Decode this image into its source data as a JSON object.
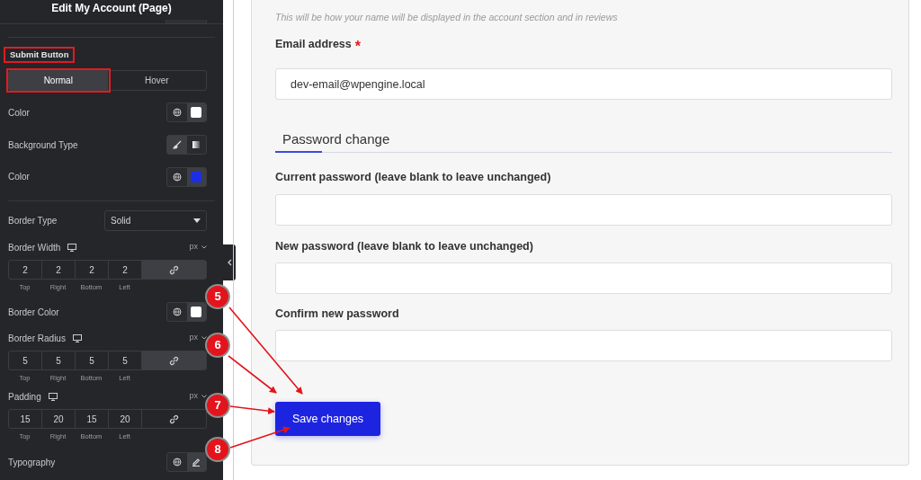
{
  "panel": {
    "title": "Edit My Account (Page)",
    "section_title": "Submit Button",
    "section_highlighted": true,
    "tabs": [
      {
        "label": "Normal",
        "selected": true,
        "highlighted": true
      },
      {
        "label": "Hover",
        "selected": false,
        "highlighted": false
      }
    ],
    "controls": [
      {
        "kind": "color",
        "label": "Color",
        "color": "#ffffff"
      },
      {
        "kind": "background",
        "label": "Background Type",
        "options": [
          {
            "selected": true
          },
          {
            "selected": false
          }
        ]
      },
      {
        "kind": "color",
        "label": "Color",
        "color": "#1a2ee6"
      },
      {
        "kind": "divider"
      },
      {
        "kind": "select",
        "label": "Border Type",
        "value": "Solid"
      },
      {
        "kind": "dimensions",
        "label": "Border Width",
        "unit": "px",
        "linked": true,
        "values": [
          {
            "value": "2",
            "label": "Top"
          },
          {
            "value": "2",
            "label": "Right"
          },
          {
            "value": "2",
            "label": "Bottom"
          },
          {
            "value": "2",
            "label": "Left"
          }
        ]
      },
      {
        "kind": "color",
        "label": "Border Color",
        "color": "#ffffff"
      },
      {
        "kind": "dimensions",
        "label": "Border Radius",
        "unit": "px",
        "linked": true,
        "values": [
          {
            "value": "5",
            "label": "Top"
          },
          {
            "value": "5",
            "label": "Right"
          },
          {
            "value": "5",
            "label": "Bottom"
          },
          {
            "value": "5",
            "label": "Left"
          }
        ]
      },
      {
        "kind": "dimensions",
        "label": "Padding",
        "unit": "px",
        "linked": false,
        "values": [
          {
            "value": "15",
            "label": "Top"
          },
          {
            "value": "20",
            "label": "Right"
          },
          {
            "value": "15",
            "label": "Bottom"
          },
          {
            "value": "20",
            "label": "Left"
          }
        ]
      },
      {
        "kind": "typography",
        "label": "Typography"
      }
    ]
  },
  "form": {
    "hint": "This will be how your name will be displayed in the account section and in reviews",
    "email": {
      "label": "Email address",
      "required_mark": "*",
      "value": "dev-email@wpengine.local"
    },
    "section_heading": "Password change",
    "password_fields": [
      {
        "label": "Current password (leave blank to leave unchanged)"
      },
      {
        "label": "New password (leave blank to leave unchanged)"
      },
      {
        "label": "Confirm new password"
      }
    ],
    "submit": "Save changes"
  },
  "callouts": [
    {
      "number": "5"
    },
    {
      "number": "6"
    },
    {
      "number": "7"
    },
    {
      "number": "8"
    }
  ]
}
